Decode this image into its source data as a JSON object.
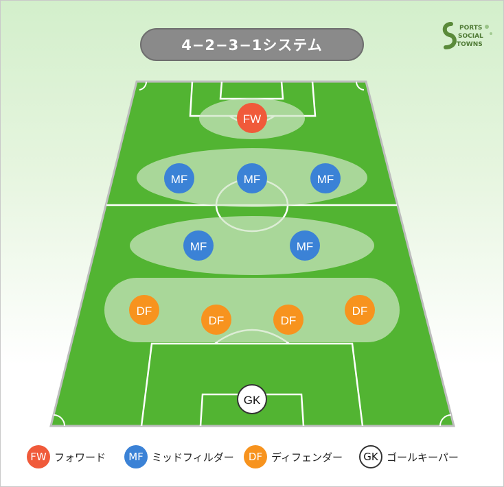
{
  "title": "4−2−3−1システム",
  "logo": {
    "text_lines": [
      "PORTS",
      "SOCIAL",
      "TOWNS"
    ]
  },
  "colors": {
    "fw": "#f05a3a",
    "mf": "#3b82d6",
    "df": "#f7931e",
    "gk_fill": "#ffffff",
    "gk_border": "#333333",
    "pitch": "#52b432",
    "zone": "#cfe6c4",
    "title_pill": "#8a8a8a"
  },
  "players": {
    "fw": [
      {
        "label": "FW"
      }
    ],
    "mf_top": [
      {
        "label": "MF"
      },
      {
        "label": "MF"
      },
      {
        "label": "MF"
      }
    ],
    "mf_mid": [
      {
        "label": "MF"
      },
      {
        "label": "MF"
      }
    ],
    "df": [
      {
        "label": "DF"
      },
      {
        "label": "DF"
      },
      {
        "label": "DF"
      },
      {
        "label": "DF"
      }
    ],
    "gk": [
      {
        "label": "GK"
      }
    ]
  },
  "legend": [
    {
      "badge": "FW",
      "text": "フォワード",
      "color": "#f05a3a"
    },
    {
      "badge": "MF",
      "text": "ミッドフィルダー",
      "color": "#3b82d6"
    },
    {
      "badge": "DF",
      "text": "ディフェンダー",
      "color": "#f7931e"
    },
    {
      "badge": "GK",
      "text": "ゴールキーパー",
      "color": "#ffffff"
    }
  ]
}
